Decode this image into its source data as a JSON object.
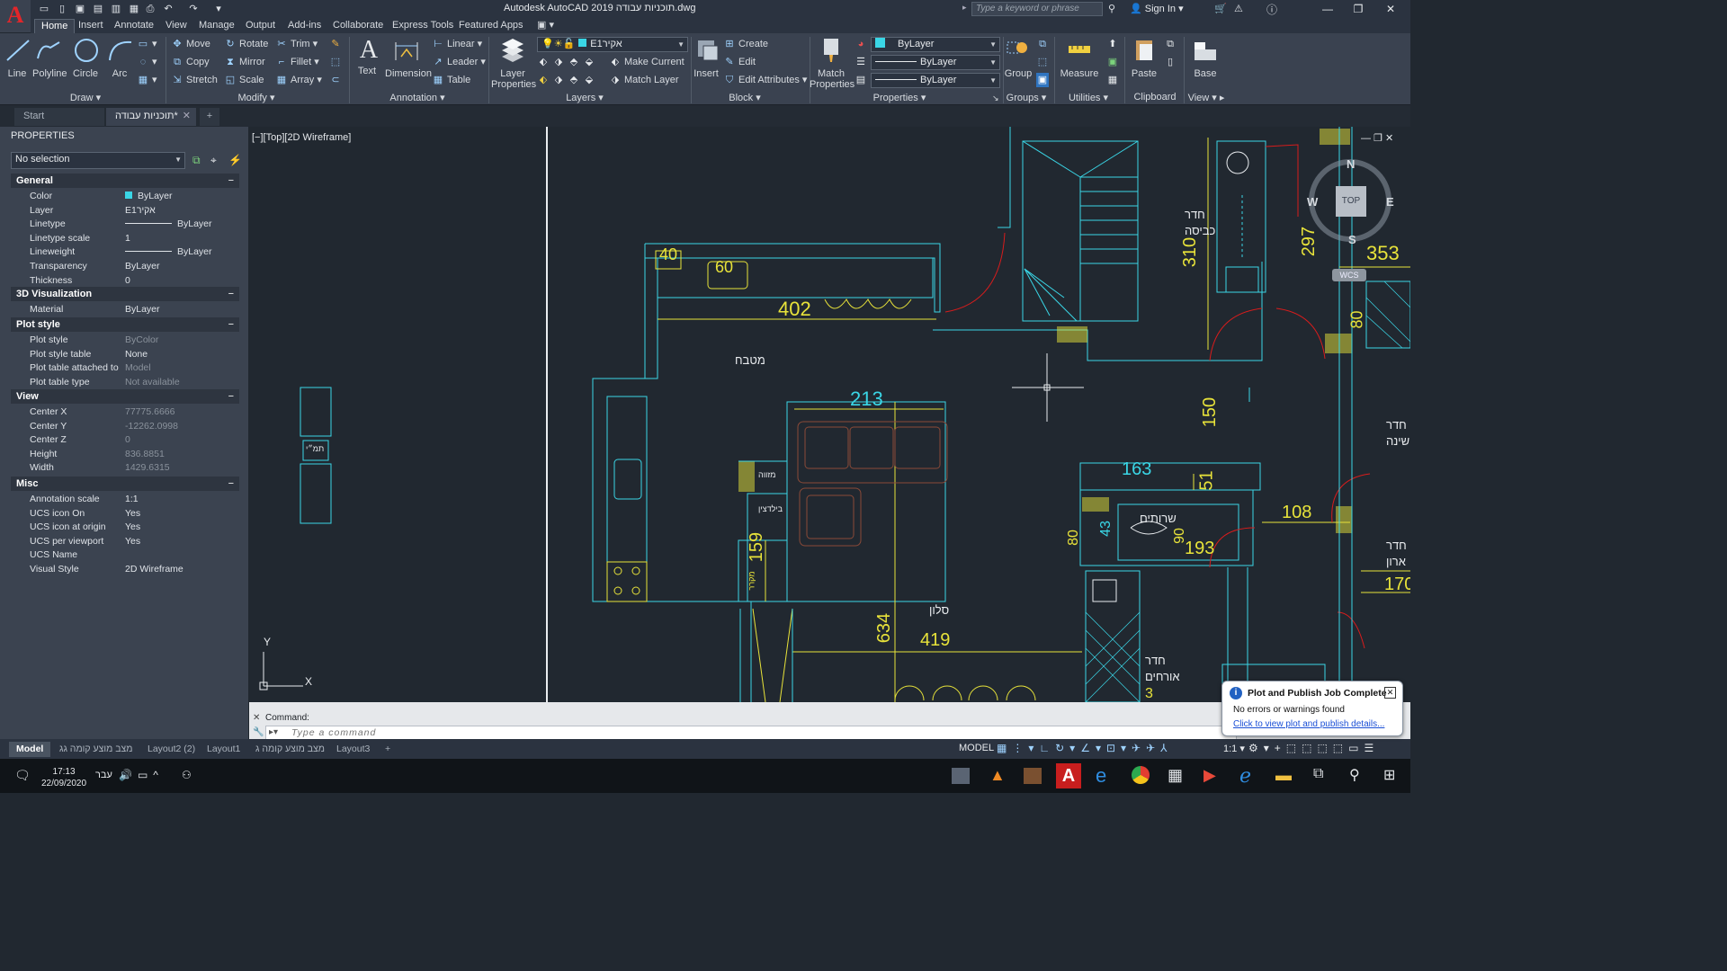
{
  "app": {
    "logo": "A",
    "title": "Autodesk AutoCAD 2019  תוכניות עבודה.dwg",
    "search_placeholder": "Type a keyword or phrase",
    "sign_in": "Sign In"
  },
  "ribbon_tabs": [
    "Home",
    "Insert",
    "Annotate",
    "View",
    "Manage",
    "Output",
    "Add-ins",
    "Collaborate",
    "Express Tools",
    "Featured Apps"
  ],
  "draw": {
    "line": "Line",
    "polyline": "Polyline",
    "circle": "Circle",
    "arc": "Arc",
    "title": "Draw"
  },
  "modify": {
    "move": "Move",
    "rotate": "Rotate",
    "trim": "Trim",
    "copy": "Copy",
    "mirror": "Mirror",
    "fillet": "Fillet",
    "stretch": "Stretch",
    "scale": "Scale",
    "array": "Array",
    "title": "Modify"
  },
  "annotation": {
    "text": "Text",
    "dimension": "Dimension",
    "linear": "Linear",
    "leader": "Leader",
    "table": "Table",
    "title": "Annotation"
  },
  "layers": {
    "layer_properties": "Layer Properties",
    "current_layer": "E1אקיר",
    "make_current": "Make Current",
    "match_layer": "Match Layer",
    "title": "Layers"
  },
  "block": {
    "insert": "Insert",
    "create": "Create",
    "edit": "Edit",
    "edit_attributes": "Edit Attributes",
    "title": "Block"
  },
  "properties_panel": {
    "match_properties": "Match Properties",
    "color": "ByLayer",
    "linetype": "ByLayer",
    "lineweight": "ByLayer",
    "title": "Properties"
  },
  "groups": {
    "group": "Group",
    "title": "Groups"
  },
  "utilities": {
    "measure": "Measure",
    "title": "Utilities"
  },
  "clipboard": {
    "paste": "Paste",
    "title": "Clipboard"
  },
  "view_panel": {
    "base": "Base",
    "title": "View"
  },
  "file_tabs": [
    "Start",
    "תוכניות עבודה*"
  ],
  "properties": {
    "title": "PROPERTIES",
    "selection": "No selection",
    "sections": {
      "general": {
        "title": "General",
        "rows": [
          {
            "k": "Color",
            "v": "ByLayer"
          },
          {
            "k": "Layer",
            "v": "E1אקיר"
          },
          {
            "k": "Linetype",
            "v": "ByLayer"
          },
          {
            "k": "Linetype scale",
            "v": "1"
          },
          {
            "k": "Lineweight",
            "v": "ByLayer"
          },
          {
            "k": "Transparency",
            "v": "ByLayer"
          },
          {
            "k": "Thickness",
            "v": "0"
          }
        ]
      },
      "viz": {
        "title": "3D Visualization",
        "rows": [
          {
            "k": "Material",
            "v": "ByLayer"
          }
        ]
      },
      "plot": {
        "title": "Plot style",
        "rows": [
          {
            "k": "Plot style",
            "v": "ByColor"
          },
          {
            "k": "Plot style table",
            "v": "None"
          },
          {
            "k": "Plot table attached to",
            "v": "Model"
          },
          {
            "k": "Plot table type",
            "v": "Not available"
          }
        ]
      },
      "view": {
        "title": "View",
        "rows": [
          {
            "k": "Center X",
            "v": "77775.6666"
          },
          {
            "k": "Center Y",
            "v": "-12262.0998"
          },
          {
            "k": "Center Z",
            "v": "0"
          },
          {
            "k": "Height",
            "v": "836.8851"
          },
          {
            "k": "Width",
            "v": "1429.6315"
          }
        ]
      },
      "misc": {
        "title": "Misc",
        "rows": [
          {
            "k": "Annotation scale",
            "v": "1:1"
          },
          {
            "k": "UCS icon On",
            "v": "Yes"
          },
          {
            "k": "UCS icon at origin",
            "v": "Yes"
          },
          {
            "k": "UCS per viewport",
            "v": "Yes"
          },
          {
            "k": "UCS Name",
            "v": ""
          },
          {
            "k": "Visual Style",
            "v": "2D Wireframe"
          }
        ]
      }
    }
  },
  "viewport": {
    "label": "[−][Top][2D Wireframe]",
    "viewcube": {
      "top": "TOP",
      "n": "N",
      "s": "S",
      "e": "E",
      "w": "W",
      "wcs": "WCS"
    },
    "rooms": [
      "מטבח",
      "סלון",
      "שרותים",
      "חדר",
      "כביסה",
      "חדר",
      "שינה",
      "חדר",
      "ארון",
      "חדר",
      "אורחים",
      "מזווה",
      "בילדצין",
      "מקרר",
      "תמ״י"
    ],
    "dims": [
      "40",
      "60",
      "402",
      "213",
      "150",
      "163",
      "51",
      "108",
      "193",
      "159",
      "634",
      "419",
      "310",
      "297",
      "353",
      "80",
      "170",
      "90",
      "80",
      "43",
      "3"
    ],
    "ucs_x": "X",
    "ucs_y": "Y"
  },
  "command": {
    "history": "Command:",
    "placeholder": "Type a command"
  },
  "layout_tabs": [
    "Model",
    "מצב מוצע קומה גג",
    "Layout2 (2)",
    "Layout1",
    "מצב מוצע קומה ג",
    "Layout3"
  ],
  "status": {
    "model": "MODEL",
    "scale": "1:1"
  },
  "taskbar": {
    "time": "17:13",
    "date": "22/09/2020",
    "lang": "עבר"
  },
  "toast": {
    "title": "Plot and Publish Job Complete",
    "message": "No errors or warnings found",
    "link": "Click to view plot and publish details..."
  },
  "colors": {
    "cyan": "#3ad6e6",
    "yellow": "#e8e33a",
    "red": "#d81c1c",
    "brown": "#8a4a38",
    "white": "#e9ecef"
  }
}
